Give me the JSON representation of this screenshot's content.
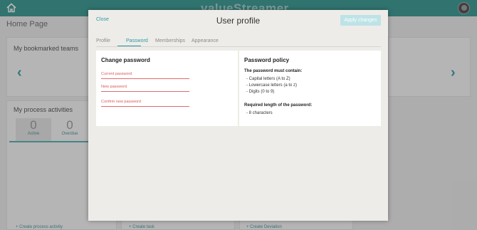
{
  "topbar": {
    "brand": "valueStreamer",
    "home_icon": "home-icon",
    "accent": "#14867e"
  },
  "background": {
    "page_title": "Home Page",
    "bookmarked_title": "My bookmarked teams",
    "activities_title": "My process activities",
    "active_count": "0",
    "active_label": "Active",
    "overdue_count": "0",
    "overdue_label": "Overdue",
    "create_process_activity": "+ Create process activity",
    "create_task": "+ Create task",
    "create_deviation": "+ Create Deviation"
  },
  "modal": {
    "close_label": "Close",
    "title": "User profile",
    "apply_label": "Apply changes",
    "tabs": [
      {
        "label": "Profile",
        "active": false
      },
      {
        "label": "Password",
        "active": true
      },
      {
        "label": "Memberships",
        "active": false
      },
      {
        "label": "Appearance",
        "active": false
      }
    ],
    "change_password": {
      "title": "Change password",
      "current_label": "Current password",
      "new_label": "New password",
      "confirm_label": "Confirm new password"
    },
    "policy": {
      "title": "Password policy",
      "must_contain_label": "The password must contain:",
      "rules": [
        "- Capital letters (A to Z)",
        "- Lowercase letters (a to z)",
        "- Digits (0 to 9)"
      ],
      "length_label": "Required length of the password:",
      "length_rule": "- 8 characters"
    }
  }
}
